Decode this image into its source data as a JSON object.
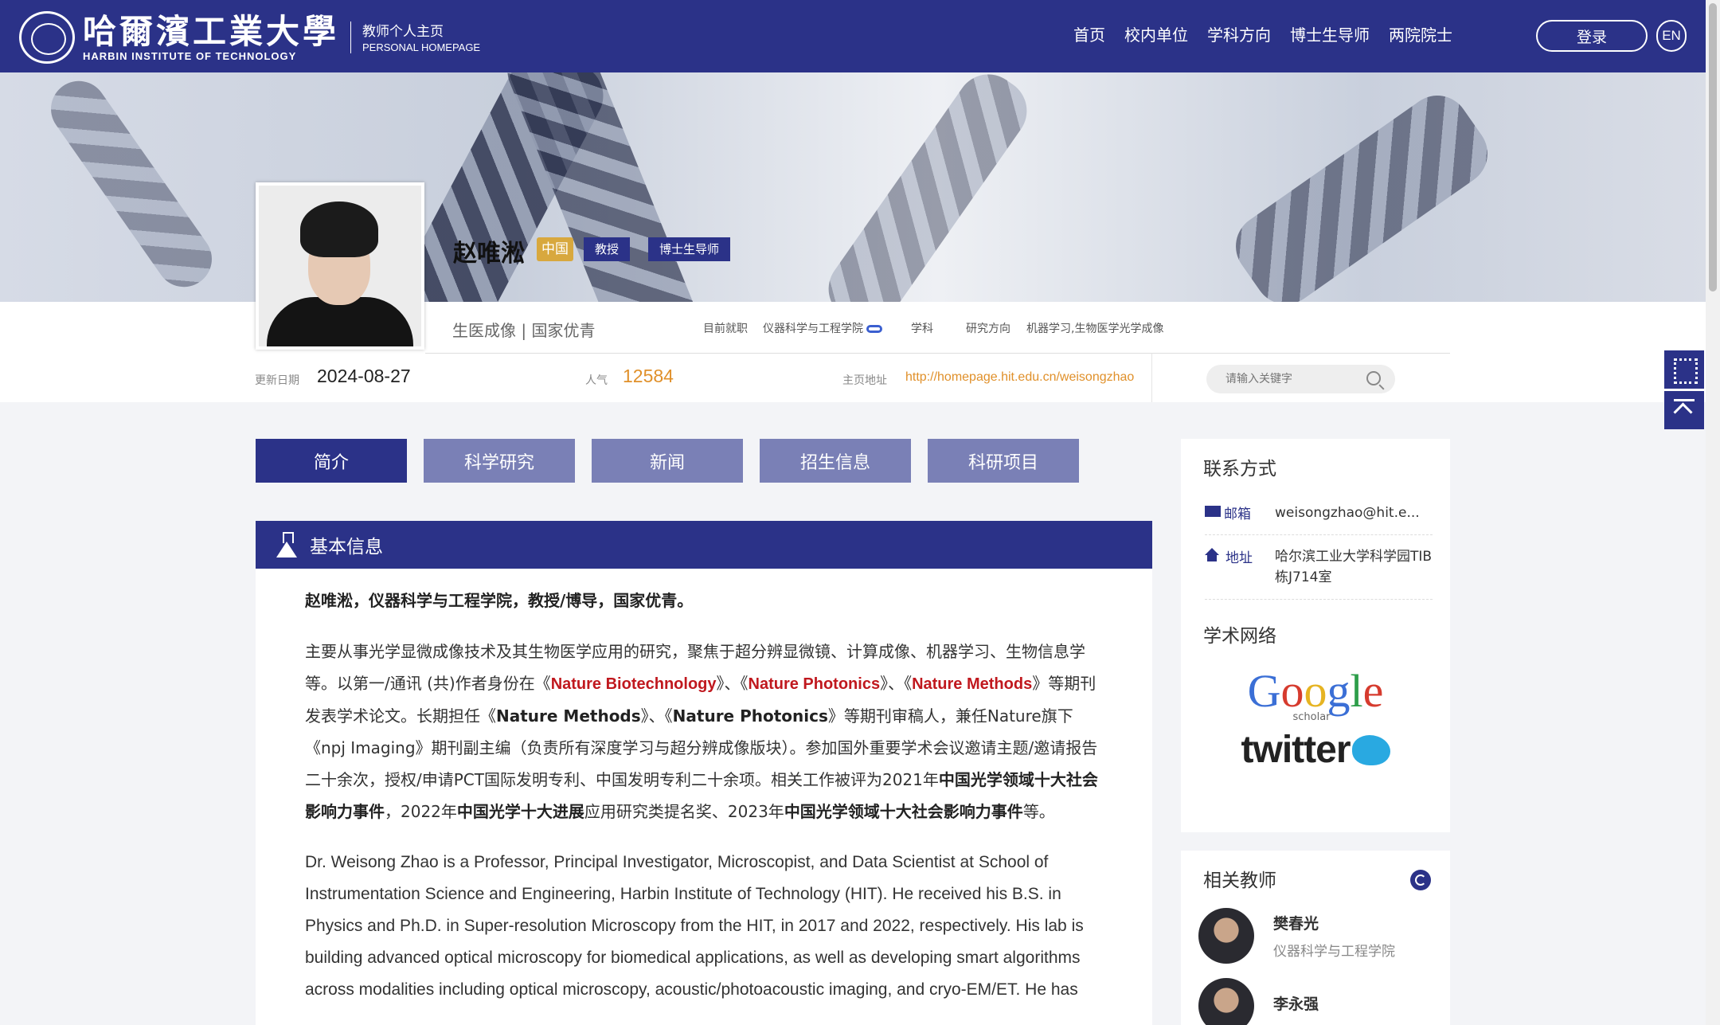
{
  "header": {
    "logo_cn": "哈爾濱工業大學",
    "logo_en": "HARBIN INSTITUTE OF TECHNOLOGY",
    "homepage_cn": "教师个人主页",
    "homepage_en": "PERSONAL HOMEPAGE",
    "nav": [
      "首页",
      "校内单位",
      "学科方向",
      "博士生导师",
      "两院院士"
    ],
    "login": "登录",
    "lang": "EN"
  },
  "profile": {
    "name": "赵唯淞",
    "tag_country": "中国",
    "tag_title": "教授",
    "tag_supervisor": "博士生导师",
    "motto": "生医成像 | 国家优青",
    "employer_label": "目前就职",
    "employer": "仪器科学与工程学院",
    "discipline_label": "学科",
    "research_label": "研究方向",
    "research": "机器学习,生物医学光学成像",
    "updated_label": "更新日期",
    "updated": "2024-08-27",
    "popularity_label": "人气",
    "popularity": "12584",
    "url_label": "主页地址",
    "url": "http://homepage.hit.edu.cn/weisongzhao",
    "search_placeholder": "请输入关键字"
  },
  "tabs": [
    "简介",
    "科学研究",
    "新闻",
    "招生信息",
    "科研项目"
  ],
  "section": {
    "title": "基本信息",
    "lead": "赵唯淞，仪器科学与工程学院，教授/博导，国家优青。",
    "p1_a": "主要从事光学显微成像技术及其生物医学应用的研究，聚焦于超分辨显微镜、计算成像、机器学习、生物信息学等。以第一/通讯 (共)作者身份在《",
    "p1_nbt": "Nature Biotechnology",
    "p1_b": "》、《",
    "p1_np": "Nature Photonics",
    "p1_c": "》、《",
    "p1_nm": "Nature Methods",
    "p1_d": "》等期刊发表学术论文。长期担任《",
    "p1_nm2": "Nature Methods",
    "p1_e": "》、《",
    "p1_np2": "Nature Photonics",
    "p1_f": "》等期刊审稿人，兼任Nature旗下《npj Imaging》期刊副主编（负责所有深度学习与超分辨成像版块）。参加国外重要学术会议邀请主题/邀请报告二十余次，授权/申请PCT国际发明专利、中国发明专利二十余项。相关工作被评为2021年",
    "p1_award1": "中国光学领域十大社会影响力事件",
    "p1_g": "，2022年",
    "p1_award2": "中国光学十大进展",
    "p1_h": "应用研究类提名奖、2023年",
    "p1_award3": "中国光学领域十大社会影响力事件",
    "p1_i": "等。",
    "p2": "Dr. Weisong Zhao is a Professor, Principal Investigator, Microscopist, and Data Scientist at School of Instrumentation Science and Engineering, Harbin Institute of Technology (HIT). He received his B.S. in Physics and Ph.D. in Super-resolution Microscopy from the HIT, in 2017 and 2022, respectively. His lab is building advanced optical microscopy for biomedical applications, as well as developing smart algorithms across modalities including optical microscopy, acoustic/photoacoustic imaging, and cryo-EM/ET. He has"
  },
  "sidebar": {
    "contact_title": "联系方式",
    "email_label": "邮箱",
    "email": "weisongzhao@hit.e...",
    "address_label": "地址",
    "address": "哈尔滨工业大学科学园TIB栋J714室",
    "network_title": "学术网络",
    "google_scholar": "scholar",
    "twitter": "twitter",
    "related_title": "相关教师",
    "teachers": [
      {
        "name": "樊春光",
        "dept": "仪器科学与工程学院"
      },
      {
        "name": "李永强",
        "dept": ""
      }
    ]
  },
  "colors": {
    "primary": "#2b3288",
    "tab_inactive": "#7a80b6",
    "accent_orange": "#e0902a",
    "gold_tag": "#d8a83e",
    "journal_red": "#c0181e"
  }
}
